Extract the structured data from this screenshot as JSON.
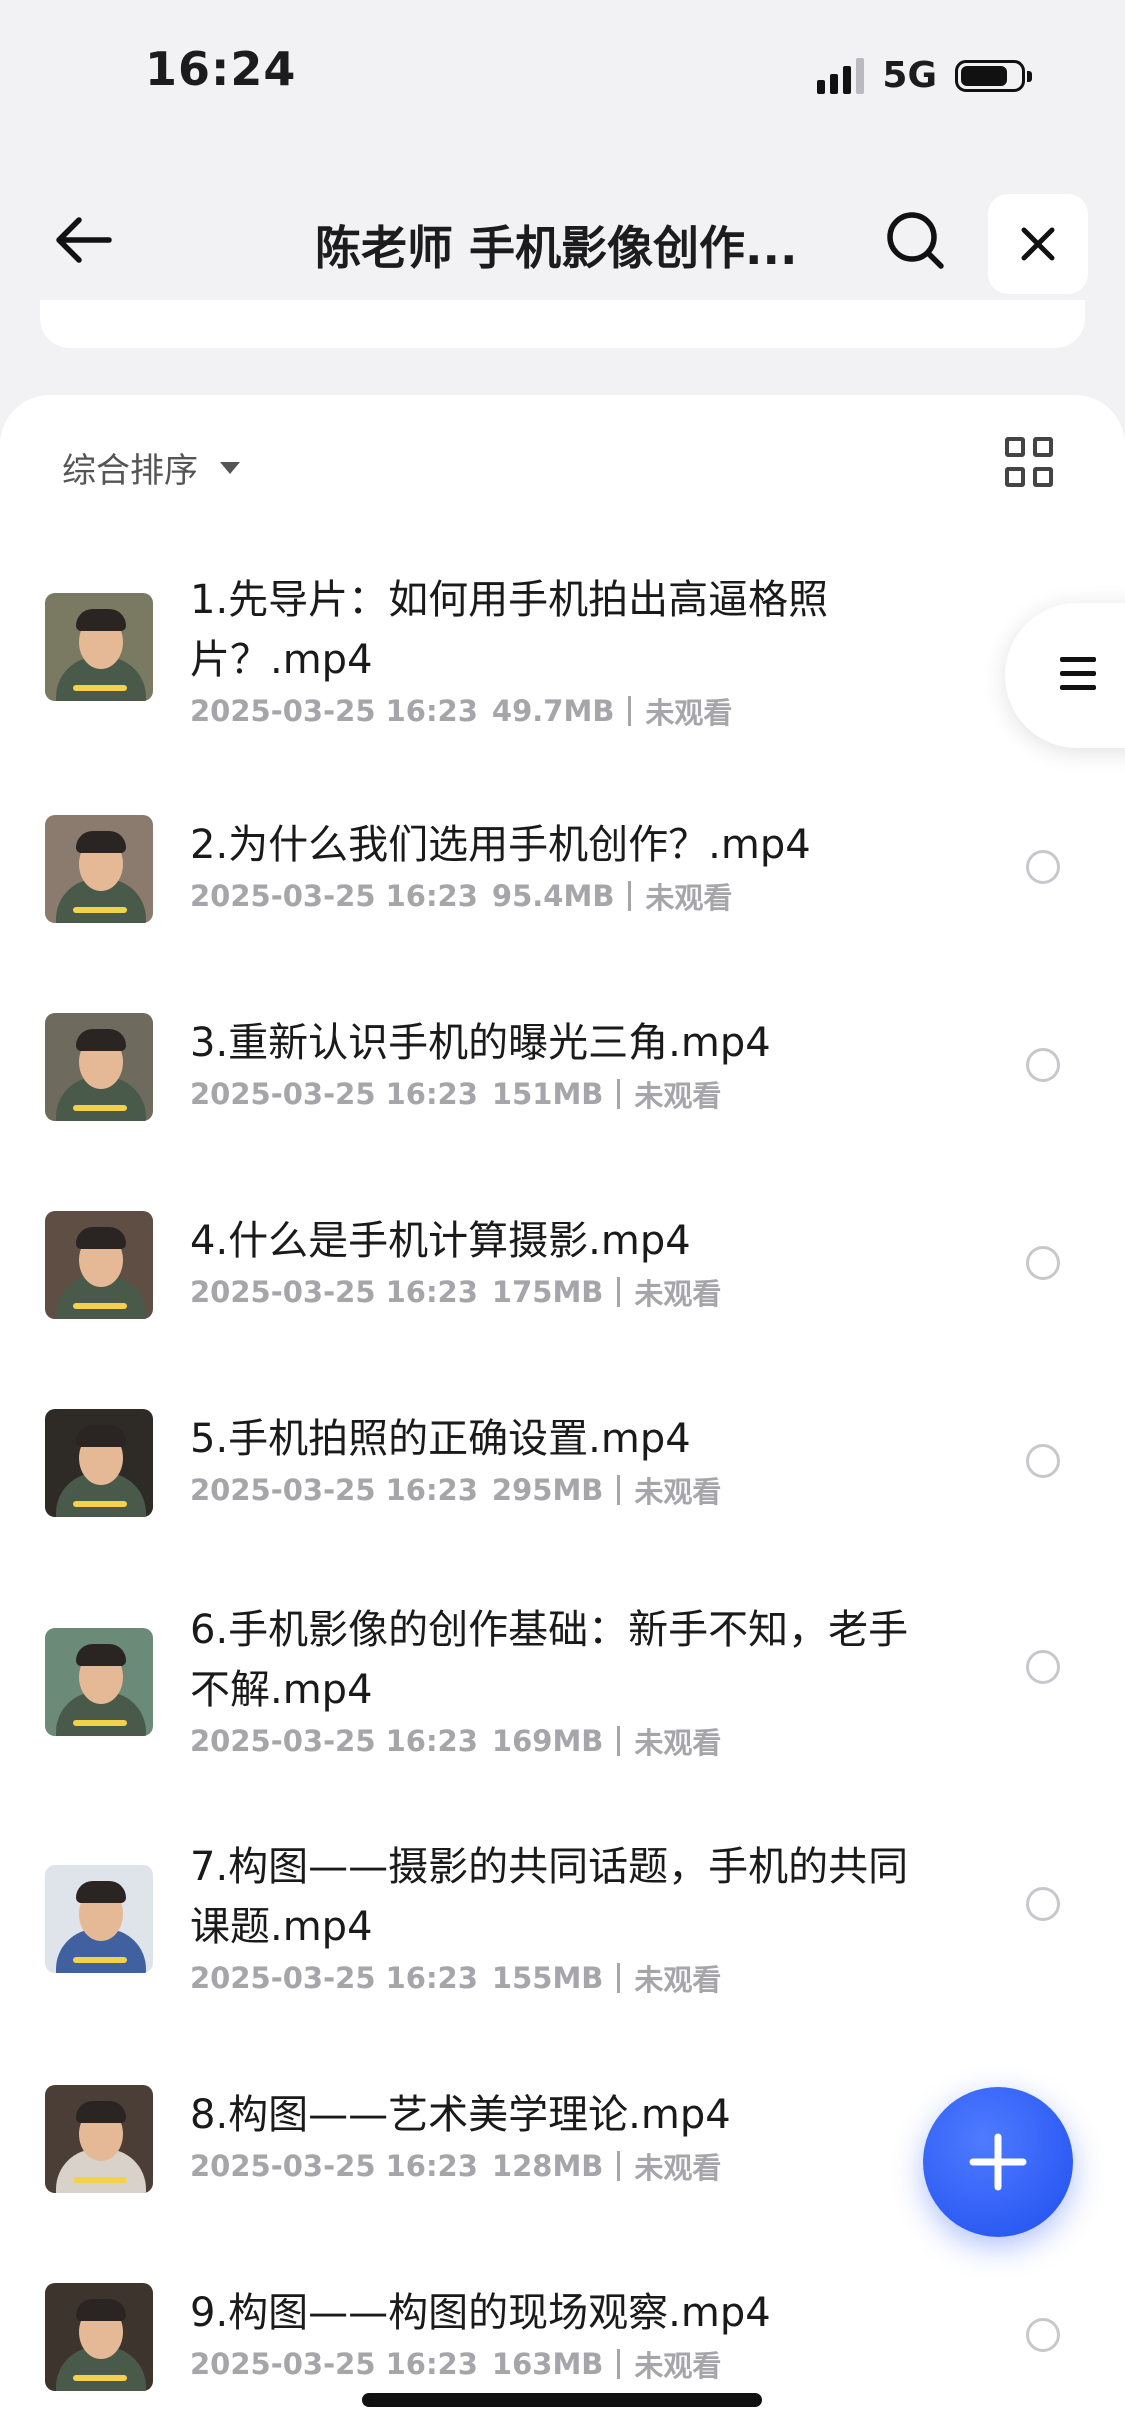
{
  "status": {
    "time": "16:24",
    "network": "5G"
  },
  "nav": {
    "title": "陈老师 手机影像创作..."
  },
  "sort": {
    "label": "综合排序"
  },
  "items": [
    {
      "title": "1.先导片：如何用手机拍出高逼格照片？.mp4",
      "date": "2025-03-25 16:23",
      "size": "49.7MB",
      "status": "未观看"
    },
    {
      "title": "2.为什么我们选用手机创作？.mp4",
      "date": "2025-03-25 16:23",
      "size": "95.4MB",
      "status": "未观看"
    },
    {
      "title": "3.重新认识手机的曝光三角.mp4",
      "date": "2025-03-25 16:23",
      "size": "151MB",
      "status": "未观看"
    },
    {
      "title": "4.什么是手机计算摄影.mp4",
      "date": "2025-03-25 16:23",
      "size": "175MB",
      "status": "未观看"
    },
    {
      "title": "5.手机拍照的正确设置.mp4",
      "date": "2025-03-25 16:23",
      "size": "295MB",
      "status": "未观看"
    },
    {
      "title": "6.手机影像的创作基础：新手不知，老手不解.mp4",
      "date": "2025-03-25 16:23",
      "size": "169MB",
      "status": "未观看"
    },
    {
      "title": "7.构图——摄影的共同话题，手机的共同课题.mp4",
      "date": "2025-03-25 16:23",
      "size": "155MB",
      "status": "未观看"
    },
    {
      "title": "8.构图——艺术美学理论.mp4",
      "date": "2025-03-25 16:23",
      "size": "128MB",
      "status": "未观看"
    },
    {
      "title": "9.构图——构图的现场观察.mp4",
      "date": "2025-03-25 16:23",
      "size": "163MB",
      "status": "未观看"
    }
  ]
}
